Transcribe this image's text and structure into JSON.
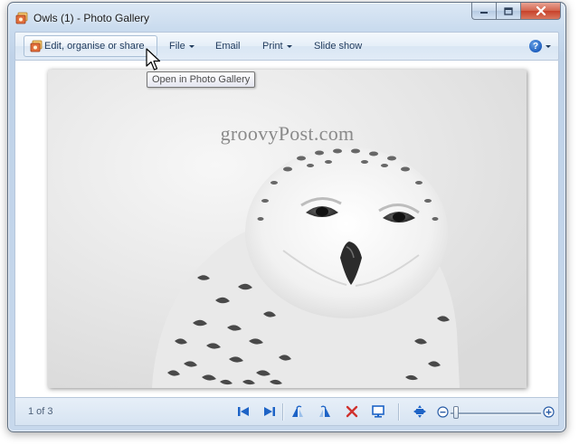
{
  "window": {
    "title": "Owls (1) - Photo Gallery"
  },
  "toolbar": {
    "edit_label": "Edit, organise or share",
    "file_label": "File",
    "email_label": "Email",
    "print_label": "Print",
    "slideshow_label": "Slide show",
    "help_icon": "?"
  },
  "tooltip": {
    "text": "Open in Photo Gallery"
  },
  "photo": {
    "watermark": "groovyPost.com",
    "subject": "snowy-owl"
  },
  "statusbar": {
    "page_count": "1 of 3",
    "icons": [
      "previous-icon",
      "next-icon",
      "rotate-left-icon",
      "rotate-right-icon",
      "delete-icon",
      "slideshow-icon",
      "actual-size-icon",
      "zoom-out-icon",
      "zoom-in-icon"
    ]
  },
  "colors": {
    "accent_blue": "#1d63c6",
    "delete_red": "#d0312d",
    "toolbar_text": "#1e395b"
  }
}
